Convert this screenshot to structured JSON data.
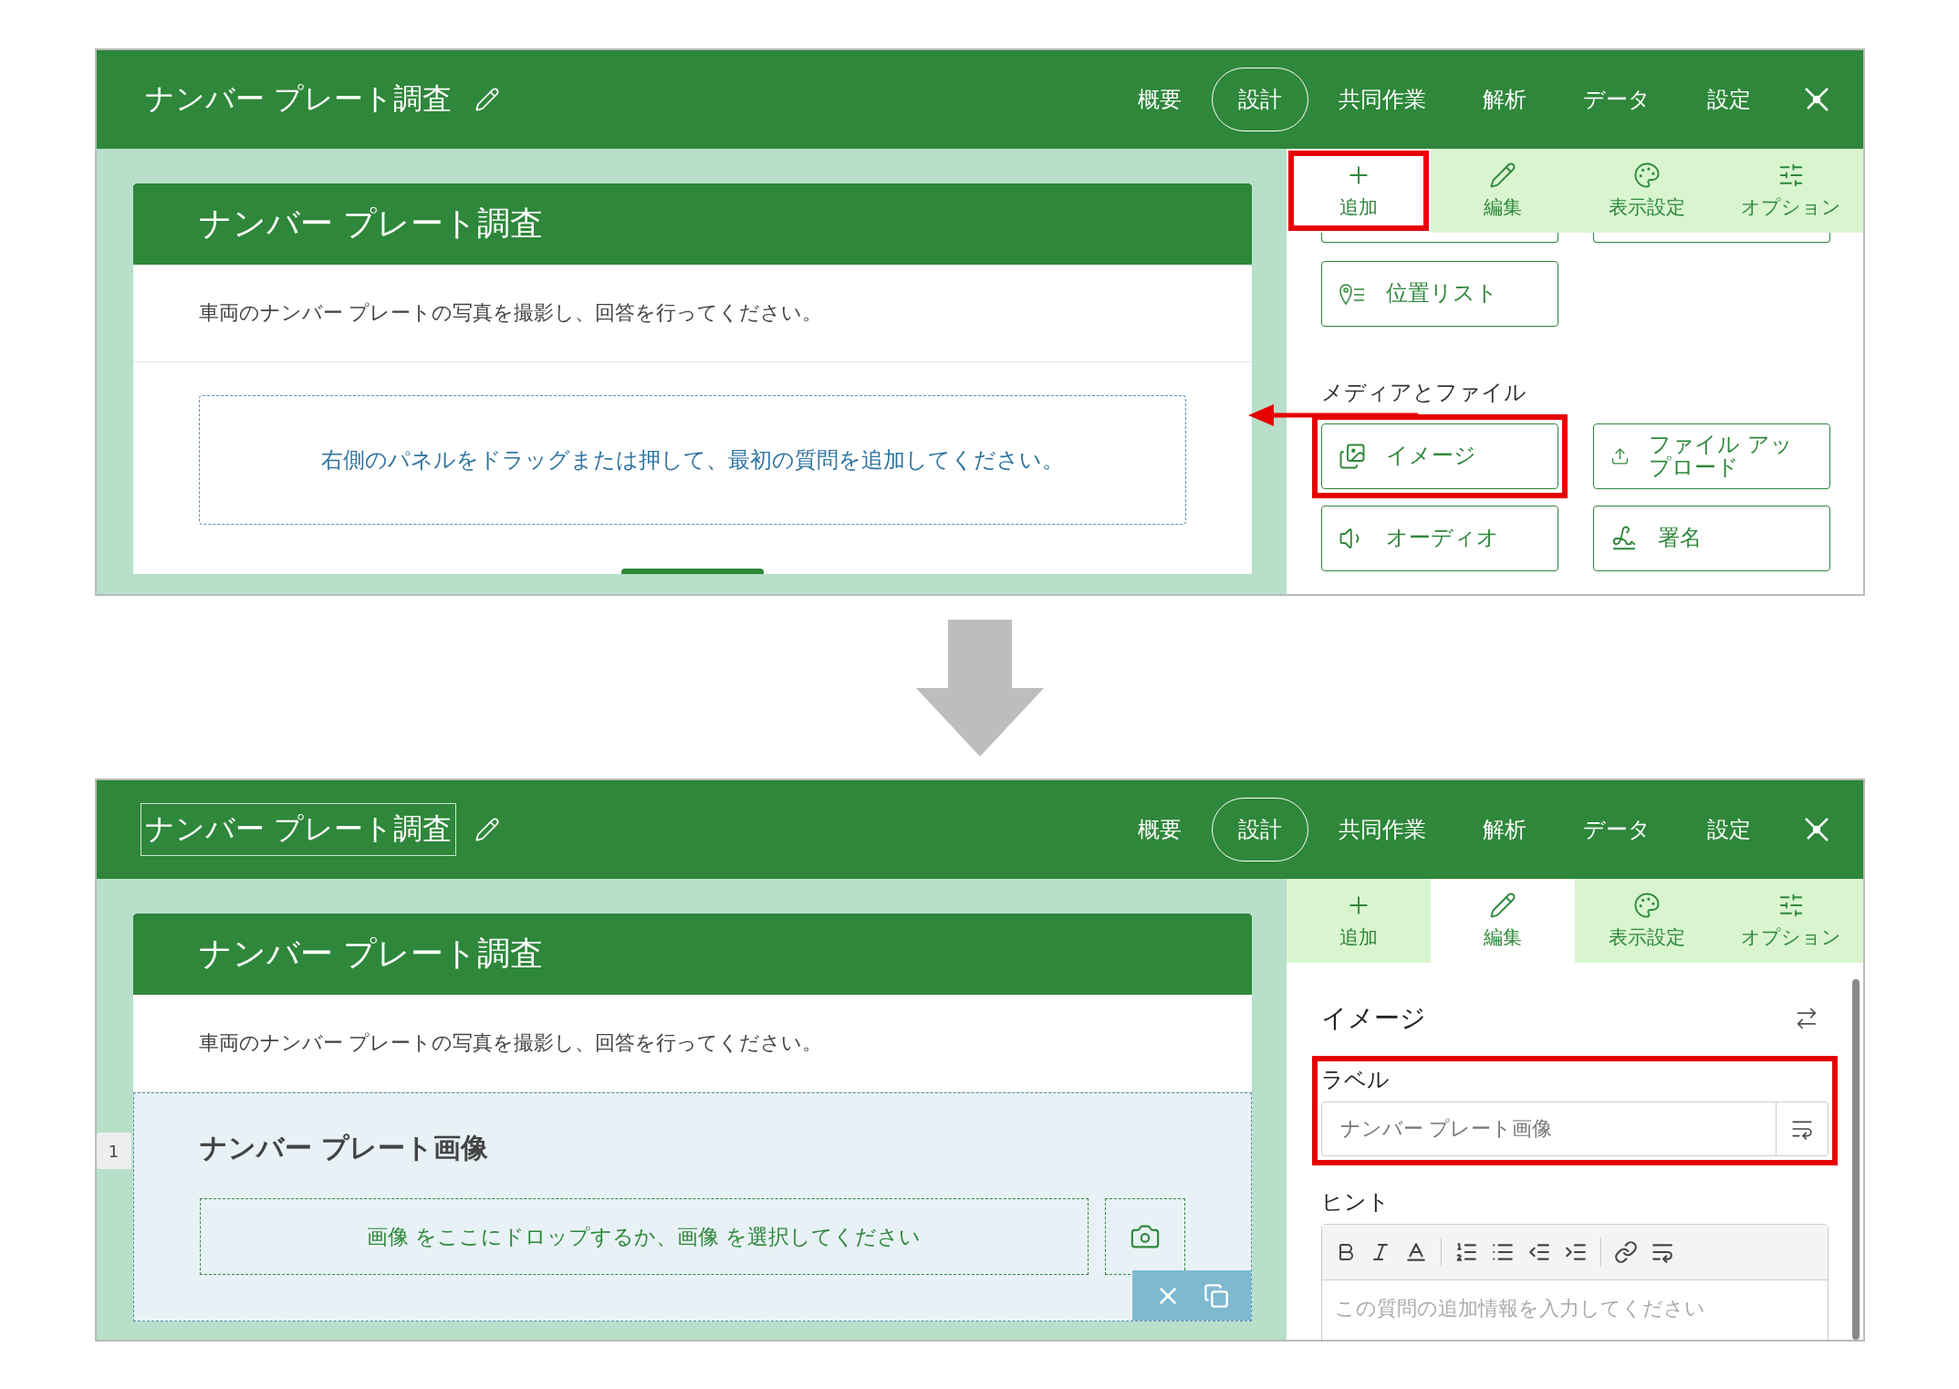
{
  "screens": [
    {
      "header": {
        "title": "ナンバー プレート調査",
        "title_editing": false,
        "nav": [
          {
            "label": "概要",
            "selected": false
          },
          {
            "label": "設計",
            "selected": true
          },
          {
            "label": "共同作業",
            "selected": false
          },
          {
            "label": "解析",
            "selected": false
          },
          {
            "label": "データ",
            "selected": false
          },
          {
            "label": "設定",
            "selected": false
          }
        ]
      },
      "form": {
        "title": "ナンバー プレート調査",
        "description": "車両のナンバー プレートの写真を撮影し、回答を行ってください。",
        "empty_hint": "右側のパネルをドラッグまたは押して、最初の質問を追加してください。"
      },
      "panel": {
        "kind": "add",
        "tabs": [
          {
            "label": "追加",
            "selected": true,
            "highlighted": true
          },
          {
            "label": "編集",
            "selected": false,
            "highlighted": false
          },
          {
            "label": "表示設定",
            "selected": false,
            "highlighted": false
          },
          {
            "label": "オプション",
            "selected": false,
            "highlighted": false
          }
        ],
        "groups": [
          {
            "items": [
              {
                "label": "位置リスト",
                "kind": "location",
                "highlighted": false
              }
            ]
          },
          {
            "heading": "メディアとファイル",
            "items": [
              {
                "label": "イメージ",
                "kind": "image",
                "highlighted": true
              },
              {
                "label": "ファイル アップロード",
                "kind": "upload",
                "highlighted": false
              },
              {
                "label": "オーディオ",
                "kind": "audio",
                "highlighted": false
              },
              {
                "label": "署名",
                "kind": "signature",
                "highlighted": false
              }
            ]
          }
        ]
      }
    },
    {
      "header": {
        "title": "ナンバー プレート調査",
        "title_editing": true,
        "nav": [
          {
            "label": "概要",
            "selected": false
          },
          {
            "label": "設計",
            "selected": true
          },
          {
            "label": "共同作業",
            "selected": false
          },
          {
            "label": "解析",
            "selected": false
          },
          {
            "label": "データ",
            "selected": false
          },
          {
            "label": "設定",
            "selected": false
          }
        ]
      },
      "form": {
        "title": "ナンバー プレート調査",
        "description": "車両のナンバー プレートの写真を撮影し、回答を行ってください。",
        "questions": [
          {
            "number": "1",
            "title": "ナンバー プレート画像",
            "drop_hint": "画像 をここにドロップするか、画像 を選択してください",
            "selected": true
          }
        ]
      },
      "panel": {
        "kind": "edit",
        "tabs": [
          {
            "label": "追加",
            "selected": false,
            "highlighted": false
          },
          {
            "label": "編集",
            "selected": true,
            "highlighted": false
          },
          {
            "label": "表示設定",
            "selected": false,
            "highlighted": false
          },
          {
            "label": "オプション",
            "selected": false,
            "highlighted": false
          }
        ],
        "heading": "イメージ",
        "fields": [
          {
            "kind": "text",
            "label": "ラベル",
            "value": "ナンバー プレート画像",
            "highlighted": true
          },
          {
            "kind": "rich",
            "label": "ヒント",
            "placeholder": "この質問の追加情報を入力してください",
            "highlighted": false
          }
        ]
      }
    }
  ]
}
